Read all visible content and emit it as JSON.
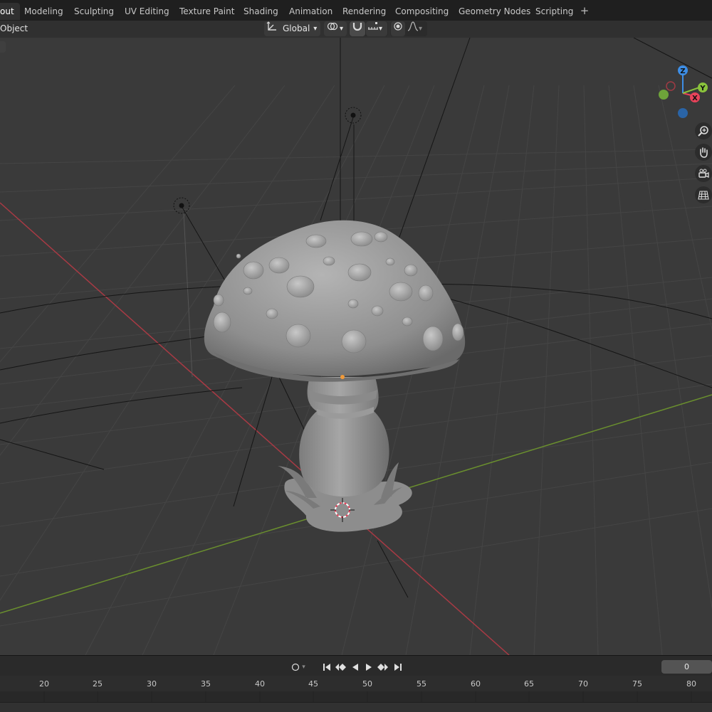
{
  "workspace_tabs": [
    {
      "label": "out",
      "active": true
    },
    {
      "label": "Modeling",
      "active": false
    },
    {
      "label": "Sculpting",
      "active": false
    },
    {
      "label": "UV Editing",
      "active": false
    },
    {
      "label": "Texture Paint",
      "active": false
    },
    {
      "label": "Shading",
      "active": false
    },
    {
      "label": "Animation",
      "active": false
    },
    {
      "label": "Rendering",
      "active": false
    },
    {
      "label": "Compositing",
      "active": false
    },
    {
      "label": "Geometry Nodes",
      "active": false
    },
    {
      "label": "Scripting",
      "active": false
    }
  ],
  "add_workspace_label": "+",
  "header": {
    "mode_label": "Object",
    "orientation_label": "Global"
  },
  "gizmo": {
    "x_label": "X",
    "y_label": "Y",
    "z_label": "Z"
  },
  "colors": {
    "x_axis": "#e8435a",
    "y_axis": "#8ac33c",
    "z_axis": "#3d8ee6",
    "viewport_bg": "#3a3a3a",
    "active_origin": "#f09a3a"
  },
  "nav_icons": [
    "zoom-icon",
    "hand-pan-icon",
    "camera-icon",
    "grid-ortho-icon"
  ],
  "timeline": {
    "current_frame": "0",
    "ruler_ticks": [
      "20",
      "25",
      "30",
      "35",
      "40",
      "45",
      "50",
      "55",
      "60",
      "65",
      "70",
      "75",
      "80"
    ]
  }
}
